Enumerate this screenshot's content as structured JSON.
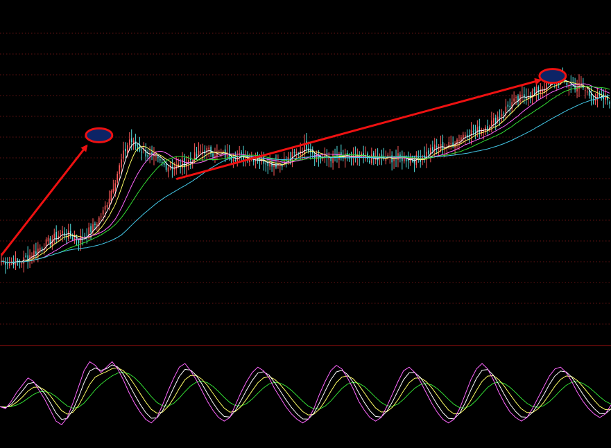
{
  "colors": {
    "background": "#000000",
    "grid": "#8a1a1a",
    "divider": "#a01010",
    "candle_up": "#ff5a5a",
    "candle_down": "#54e0e0",
    "ma5": "#ffffff",
    "ma10": "#ffff66",
    "ma20": "#ff66ff",
    "ma30": "#33dd33",
    "ma60": "#44c8e8",
    "annotation": "#ee1111",
    "marker_fill": "#0d2466",
    "osc_k": "#ffffff",
    "osc_d": "#ffff66",
    "osc_j": "#ff66ff",
    "osc_m": "#33dd33"
  },
  "chart_data": [
    {
      "type": "line",
      "panel": "price",
      "title": "",
      "xlabel": "",
      "ylabel": "",
      "grid": true,
      "ylim": [
        0,
        100
      ],
      "bars": 300,
      "close_anchors": [
        [
          0,
          8
        ],
        [
          10,
          8
        ],
        [
          20,
          18
        ],
        [
          30,
          27
        ],
        [
          38,
          22
        ],
        [
          45,
          30
        ],
        [
          50,
          40
        ],
        [
          55,
          58
        ],
        [
          60,
          78
        ],
        [
          63,
          88
        ],
        [
          66,
          84
        ],
        [
          72,
          78
        ],
        [
          80,
          71
        ],
        [
          86,
          70
        ],
        [
          92,
          74
        ],
        [
          100,
          81
        ],
        [
          108,
          78
        ],
        [
          116,
          77
        ],
        [
          124,
          76
        ],
        [
          135,
          72
        ],
        [
          140,
          74
        ],
        [
          150,
          84
        ],
        [
          156,
          76
        ],
        [
          165,
          76
        ],
        [
          175,
          76
        ],
        [
          185,
          75
        ],
        [
          195,
          76
        ],
        [
          205,
          75
        ],
        [
          212,
          82
        ],
        [
          220,
          84
        ],
        [
          228,
          92
        ],
        [
          235,
          94
        ],
        [
          242,
          100
        ],
        [
          250,
          111
        ],
        [
          258,
          117
        ],
        [
          265,
          121
        ],
        [
          272,
          126
        ],
        [
          275,
          127
        ],
        [
          280,
          123
        ],
        [
          285,
          123
        ],
        [
          290,
          116
        ],
        [
          295,
          115
        ],
        [
          299,
          114
        ]
      ],
      "series": [
        {
          "name": "",
          "role": "ma",
          "period": 5
        },
        {
          "name": "",
          "role": "ma",
          "period": 10
        },
        {
          "name": "",
          "role": "ma",
          "period": 20
        },
        {
          "name": "",
          "role": "ma",
          "period": 30
        },
        {
          "name": "",
          "role": "ma",
          "period": 60
        }
      ],
      "annotations": [
        {
          "kind": "arrow",
          "from_bar": 0,
          "from_value": 12,
          "to_bar": 42,
          "to_value": 84
        },
        {
          "kind": "arrow",
          "from_bar": 86,
          "from_value": 62,
          "to_bar": 265,
          "to_value": 127
        },
        {
          "kind": "ellipse",
          "at_bar": 48,
          "at_value": 88
        },
        {
          "kind": "ellipse",
          "at_bar": 271,
          "at_value": 127
        }
      ]
    },
    {
      "type": "line",
      "panel": "oscillator",
      "title": "",
      "xlabel": "",
      "ylabel": "",
      "grid": false,
      "ylim": [
        0,
        100
      ],
      "series": [
        {
          "name": "",
          "role": "j",
          "values": [
            42,
            40,
            48,
            58,
            66,
            74,
            70,
            60,
            50,
            38,
            26,
            22,
            30,
            46,
            64,
            82,
            92,
            88,
            80,
            86,
            92,
            84,
            72,
            58,
            46,
            36,
            28,
            24,
            30,
            44,
            60,
            74,
            86,
            90,
            82,
            72,
            60,
            48,
            38,
            30,
            26,
            30,
            44,
            58,
            70,
            80,
            86,
            82,
            74,
            62,
            52,
            42,
            34,
            28,
            24,
            28,
            40,
            56,
            70,
            82,
            88,
            84,
            74,
            62,
            48,
            38,
            30,
            26,
            30,
            42,
            56,
            70,
            82,
            86,
            80,
            70,
            58,
            46,
            36,
            28,
            24,
            28,
            40,
            56,
            72,
            84,
            90,
            84,
            72,
            58,
            46,
            36,
            30,
            26,
            30,
            40,
            52,
            64,
            76,
            84,
            86,
            80,
            70,
            58,
            48,
            40,
            34,
            30,
            34,
            44
          ]
        },
        {
          "name": "",
          "role": "k"
        },
        {
          "name": "",
          "role": "d"
        },
        {
          "name": "",
          "role": "m"
        }
      ]
    }
  ]
}
